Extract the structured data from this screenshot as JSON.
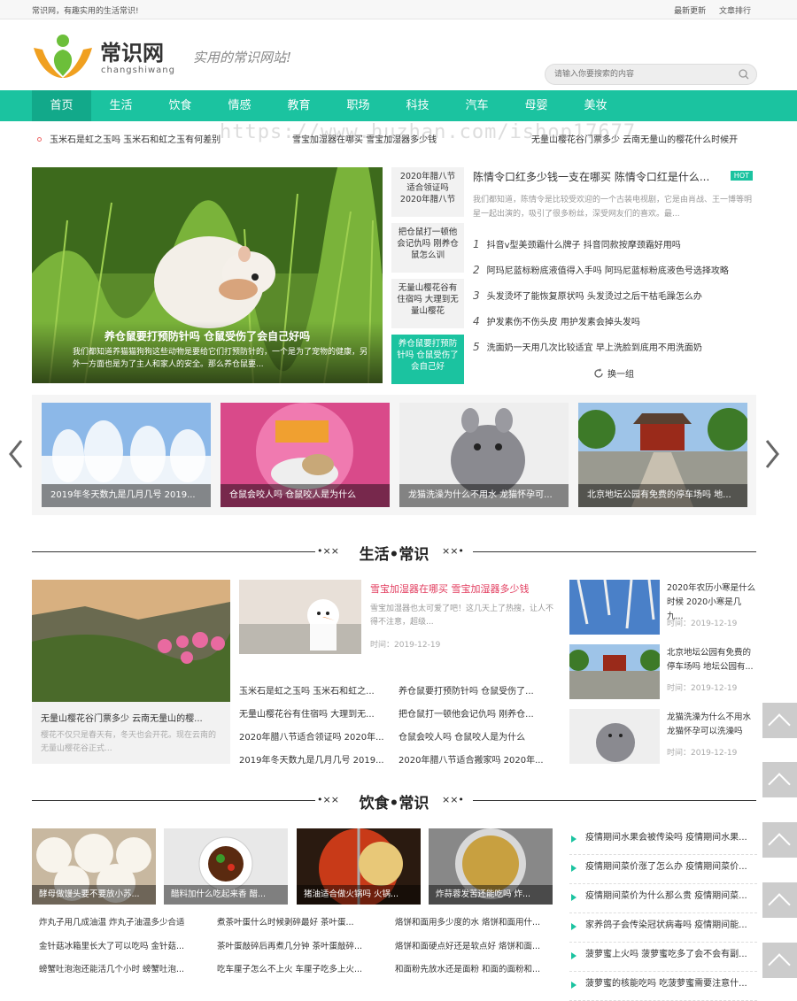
{
  "topbar": {
    "left": "常识网，有趣实用的生活常识!",
    "links": [
      "最新更新",
      "文章排行"
    ]
  },
  "header": {
    "logo_text": "常识网",
    "logo_pinyin": "changshiwang",
    "slogan": "实用的常识网站!"
  },
  "search": {
    "placeholder": "请输入你要搜索的内容"
  },
  "nav": [
    "首页",
    "生活",
    "饮食",
    "情感",
    "教育",
    "职场",
    "科技",
    "汽车",
    "母婴",
    "美妆"
  ],
  "ticker": [
    "玉米石是虹之玉吗 玉米石和虹之玉有何差别",
    "雪宝加湿器在哪买 雪宝加湿器多少钱",
    "无量山樱花谷门票多少 云南无量山的樱花什么时候开"
  ],
  "watermark": "https://www.huzhan.com/ishop17677",
  "hero": {
    "title": "养仓鼠要打预防针吗 仓鼠受伤了会自己好吗",
    "desc": "我们都知道养猫猫狗狗这些动物是要给它们打预防针的，一个是为了宠物的健康，另外一方面也是为了主人和家人的安全。那么养仓鼠要..."
  },
  "hero_thumbs": [
    "2020年腊八节适合领证吗 2020年腊八节",
    "把仓鼠打一顿他会记仇吗 刚养仓鼠怎么训",
    "无量山樱花谷有住宿吗 大理到无量山樱花",
    "养仓鼠要打预防针吗 仓鼠受伤了会自己好"
  ],
  "hot": {
    "title": "陈情令口红多少钱一支在哪买 陈情令口红是什么...",
    "badge": "HOT",
    "desc": "我们都知道，陈情令是比较受欢迎的一个古装电视剧，它是由肖战、王一博等明星一起出演的，吸引了很多粉丝，深受网友们的喜欢。最...",
    "list": [
      {
        "num": "1",
        "text": "抖音v型美颈霜什么牌子 抖音同款按摩颈霜好用吗"
      },
      {
        "num": "2",
        "text": "阿玛尼蓝标粉底液值得入手吗 阿玛尼蓝标粉底液色号选择攻略"
      },
      {
        "num": "3",
        "text": "头发烫坏了能恢复原状吗 头发烫过之后干枯毛躁怎么办"
      },
      {
        "num": "4",
        "text": "护发素伤不伤头皮 用护发素会掉头发吗"
      },
      {
        "num": "5",
        "text": "洗面奶一天用几次比较适宜 早上洗脸到底用不用洗面奶"
      }
    ],
    "refresh": "换一组"
  },
  "carousel": [
    "2019年冬天数九是几月几号 2019...",
    "仓鼠会咬人吗 仓鼠咬人是为什么",
    "龙猫洗澡为什么不用水 龙猫怀孕可...",
    "北京地坛公园有免费的停车场吗 地..."
  ],
  "life": {
    "title": "生活•常识",
    "card": {
      "title": "无量山樱花谷门票多少 云南无量山的樱...",
      "desc": "樱花不仅只是春天有，冬天也会开花。现在云南的无量山樱花谷正式..."
    },
    "feature": {
      "title": "雪宝加湿器在哪买 雪宝加湿器多少钱",
      "desc": "雪宝加湿器也太可爱了吧！这几天上了热搜，让人不得不注意，超级...",
      "date": "时间：2019-12-19"
    },
    "list": [
      "玉米石是虹之玉吗 玉米石和虹之...",
      "养仓鼠要打预防针吗 仓鼠受伤了...",
      "无量山樱花谷有住宿吗 大理到无...",
      "把仓鼠打一顿他会记仇吗 刚养仓...",
      "2020年腊八节适合领证吗 2020年...",
      "仓鼠会咬人吗 仓鼠咬人是为什么",
      "2019年冬天数九是几月几号 2019...",
      "2020年腊八节适合搬家吗 2020年..."
    ],
    "side": [
      {
        "title": "2020年农历小寒是什么时候 2020小寒是几九...",
        "date": "时间：2019-12-19"
      },
      {
        "title": "北京地坛公园有免费的停车场吗 地坛公园有...",
        "date": "时间：2019-12-19"
      },
      {
        "title": "龙猫洗澡为什么不用水 龙猫怀孕可以洗澡吗",
        "date": "时间：2019-12-19"
      }
    ]
  },
  "food": {
    "title": "饮食•常识",
    "images": [
      "酵母做馒头要不要放小苏...",
      "醋料加什么吃起来香 醋...",
      "猪油适合做火锅吗 火锅...",
      "炸蒜蓉发苦还能吃吗 炸..."
    ],
    "list": [
      "炸丸子用几成油温 炸丸子油温多少合适",
      "煮茶叶蛋什么时候剥碎最好 茶叶蛋...",
      "烙饼和面用多少度的水 烙饼和面用什...",
      "金针菇冰箱里长大了可以吃吗 金针菇...",
      "茶叶蛋敲碎后再煮几分钟 茶叶蛋敲碎...",
      "烙饼和面硬点好还是软点好 烙饼和面...",
      "螃蟹吐泡泡还能活几个小时 螃蟹吐泡...",
      "吃车厘子怎么不上火 车厘子吃多上火...",
      "和面粉先放水还是面粉 和面的面粉和..."
    ],
    "side": [
      "疫情期间水果会被传染吗 疫情期间水果...",
      "疫情期间菜价涨了怎么办 疫情期间菜价...",
      "疫情期间菜价为什么那么贵 疫情期间菜...",
      "家养鸽子会传染冠状病毒吗 疫情期间能...",
      "菠萝蜜上火吗 菠萝蜜吃多了会不会有副...",
      "菠萝蜜的核能吃吗 吃菠萝蜜需要注意什..."
    ]
  },
  "colors": {
    "accent": "#1bc3a0",
    "hot_title": "#e23c5e"
  }
}
